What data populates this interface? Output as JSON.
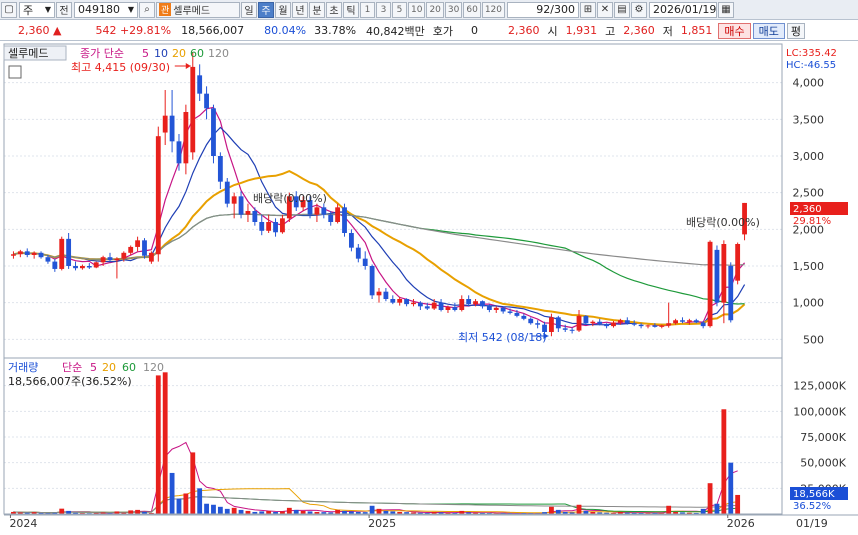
{
  "toolbar": {
    "market": "주",
    "period_prefix": "전",
    "code": "049180",
    "badge": "관",
    "name": "셀루메드",
    "periods": [
      "일",
      "주",
      "월",
      "년",
      "분",
      "초",
      "틱"
    ],
    "active_period": "주",
    "intervals": [
      "1",
      "3",
      "5",
      "10",
      "20",
      "30",
      "60",
      "120"
    ],
    "count": "92/300",
    "date": "2026/01/19"
  },
  "quote": {
    "price": "2,360",
    "arrow": "▲",
    "change": "542",
    "change_pct": "+29.81%",
    "volume": "18,566,007",
    "ratio1": "80.04%",
    "ratio2": "33.78%",
    "amount": "40,842백만",
    "hoga_label": "호가",
    "hoga_value": "0",
    "hoga_price": "2,360",
    "open_label": "시",
    "open": "1,931",
    "high_label": "고",
    "high": "2,360",
    "low_label": "저",
    "low": "1,851",
    "buy_label": "매수",
    "sell_label": "매도",
    "eval_label": "평"
  },
  "price_panel": {
    "legend_name": "셀루메드",
    "legend_ma_prefix": "종가 단순",
    "ma_periods": [
      "5",
      "10",
      "20",
      "60",
      "120"
    ],
    "lc_label": "LC:335.42",
    "hc_label": "HC:-46.55",
    "high_note": "최고 4,415 (09/30)",
    "low_note": "최저 542 (08/18)",
    "dividend_note_1": "배당락(0.00%)",
    "dividend_note_2": "배당락(0.00%)",
    "current_price_tag": "2,360",
    "current_pct_tag": "29.81%"
  },
  "volume_panel": {
    "legend_name": "거래량",
    "legend_ma_prefix": "단순",
    "ma_periods": [
      "5",
      "20",
      "60",
      "120"
    ],
    "volume_note": "18,566,007주(36.52%)",
    "current_volume_tag": "18,566K",
    "current_pct_tag": "36.52%"
  },
  "x_axis_labels": [
    "2024",
    "2025",
    "2026",
    "01/19"
  ],
  "colors": {
    "up": "#e8201c",
    "down": "#2355d6",
    "ma5": "#c71585",
    "ma10": "#1f3fb5",
    "ma20": "#e8a000",
    "ma60": "#1e9a3a",
    "ma120": "#8a8a8a"
  },
  "chart_data": [
    {
      "type": "candlestick",
      "title": "셀루메드",
      "x_range": [
        "2024-01",
        "2026-01-19"
      ],
      "y_ticks": [
        500,
        1000,
        1500,
        2000,
        2500,
        3000,
        3500,
        4000
      ],
      "ylim": [
        300,
        4500
      ],
      "grid": true,
      "candles": [
        {
          "x": "2024-01-05",
          "o": 1640,
          "h": 1700,
          "l": 1600,
          "c": 1660
        },
        {
          "x": "2024-01-12",
          "o": 1660,
          "h": 1720,
          "l": 1620,
          "c": 1700
        },
        {
          "x": "2024-01-19",
          "o": 1700,
          "h": 1740,
          "l": 1620,
          "c": 1650
        },
        {
          "x": "2024-01-26",
          "o": 1650,
          "h": 1700,
          "l": 1600,
          "c": 1680
        },
        {
          "x": "2024-02-02",
          "o": 1680,
          "h": 1700,
          "l": 1600,
          "c": 1620
        },
        {
          "x": "2024-02-09",
          "o": 1620,
          "h": 1650,
          "l": 1530,
          "c": 1560
        },
        {
          "x": "2024-02-16",
          "o": 1560,
          "h": 1600,
          "l": 1420,
          "c": 1460
        },
        {
          "x": "2024-02-23",
          "o": 1460,
          "h": 1900,
          "l": 1440,
          "c": 1870
        },
        {
          "x": "2024-03-01",
          "o": 1870,
          "h": 1950,
          "l": 1460,
          "c": 1500
        },
        {
          "x": "2024-03-08",
          "o": 1500,
          "h": 1560,
          "l": 1440,
          "c": 1470
        },
        {
          "x": "2024-03-15",
          "o": 1470,
          "h": 1520,
          "l": 1450,
          "c": 1500
        },
        {
          "x": "2024-03-22",
          "o": 1500,
          "h": 1540,
          "l": 1460,
          "c": 1480
        },
        {
          "x": "2024-03-29",
          "o": 1480,
          "h": 1560,
          "l": 1470,
          "c": 1550
        },
        {
          "x": "2024-04-05",
          "o": 1550,
          "h": 1640,
          "l": 1500,
          "c": 1620
        },
        {
          "x": "2024-04-12",
          "o": 1620,
          "h": 1680,
          "l": 1560,
          "c": 1580
        },
        {
          "x": "2024-04-19",
          "o": 1580,
          "h": 1620,
          "l": 1330,
          "c": 1600
        },
        {
          "x": "2024-04-26",
          "o": 1600,
          "h": 1700,
          "l": 1560,
          "c": 1680
        },
        {
          "x": "2024-05-03",
          "o": 1680,
          "h": 1780,
          "l": 1650,
          "c": 1760
        },
        {
          "x": "2024-05-10",
          "o": 1760,
          "h": 1900,
          "l": 1700,
          "c": 1850
        },
        {
          "x": "2024-05-17",
          "o": 1850,
          "h": 1880,
          "l": 1600,
          "c": 1640
        },
        {
          "x": "2024-05-24",
          "o": 1560,
          "h": 1700,
          "l": 1530,
          "c": 1680
        },
        {
          "x": "2024-05-31",
          "o": 1660,
          "h": 3400,
          "l": 1560,
          "c": 3270
        },
        {
          "x": "2024-06-07",
          "o": 3320,
          "h": 3900,
          "l": 3150,
          "c": 3550
        },
        {
          "x": "2024-06-14",
          "o": 3550,
          "h": 3900,
          "l": 3050,
          "c": 3200
        },
        {
          "x": "2024-06-21",
          "o": 3200,
          "h": 3300,
          "l": 2800,
          "c": 2900
        },
        {
          "x": "2024-06-28",
          "o": 2900,
          "h": 3700,
          "l": 2750,
          "c": 3600
        },
        {
          "x": "2024-07-05",
          "o": 3050,
          "h": 4415,
          "l": 2950,
          "c": 4215
        },
        {
          "x": "2024-07-12",
          "o": 4100,
          "h": 4250,
          "l": 3750,
          "c": 3850
        },
        {
          "x": "2024-07-19",
          "o": 3850,
          "h": 3950,
          "l": 3500,
          "c": 3650
        },
        {
          "x": "2024-07-26",
          "o": 3650,
          "h": 3700,
          "l": 2900,
          "c": 3000
        },
        {
          "x": "2024-08-02",
          "o": 3000,
          "h": 3050,
          "l": 2550,
          "c": 2650
        },
        {
          "x": "2024-08-09",
          "o": 2650,
          "h": 2700,
          "l": 2300,
          "c": 2350
        },
        {
          "x": "2024-08-16",
          "o": 2350,
          "h": 2500,
          "l": 2150,
          "c": 2450
        },
        {
          "x": "2024-08-23",
          "o": 2450,
          "h": 2520,
          "l": 2150,
          "c": 2200
        },
        {
          "x": "2024-08-30",
          "o": 2200,
          "h": 2350,
          "l": 2100,
          "c": 2250
        },
        {
          "x": "2024-09-06",
          "o": 2250,
          "h": 2300,
          "l": 2050,
          "c": 2100
        },
        {
          "x": "2024-09-13",
          "o": 2100,
          "h": 2200,
          "l": 1920,
          "c": 1980
        },
        {
          "x": "2024-09-20",
          "o": 1980,
          "h": 2200,
          "l": 1950,
          "c": 2100
        },
        {
          "x": "2024-09-27",
          "o": 2100,
          "h": 2150,
          "l": 1900,
          "c": 1960
        },
        {
          "x": "2024-10-04",
          "o": 1960,
          "h": 2200,
          "l": 1940,
          "c": 2150
        },
        {
          "x": "2024-10-11",
          "o": 2150,
          "h": 2500,
          "l": 2100,
          "c": 2450
        },
        {
          "x": "2024-10-18",
          "o": 2450,
          "h": 2520,
          "l": 2250,
          "c": 2300
        },
        {
          "x": "2024-10-25",
          "o": 2300,
          "h": 2450,
          "l": 2250,
          "c": 2400
        },
        {
          "x": "2024-11-01",
          "o": 2400,
          "h": 2450,
          "l": 2150,
          "c": 2200
        },
        {
          "x": "2024-11-08",
          "o": 2200,
          "h": 2350,
          "l": 2100,
          "c": 2300
        },
        {
          "x": "2024-11-15",
          "o": 2300,
          "h": 2350,
          "l": 2150,
          "c": 2200
        },
        {
          "x": "2024-11-22",
          "o": 2200,
          "h": 2250,
          "l": 2050,
          "c": 2100
        },
        {
          "x": "2024-11-29",
          "o": 2100,
          "h": 2350,
          "l": 2080,
          "c": 2300
        },
        {
          "x": "2024-12-06",
          "o": 2300,
          "h": 2350,
          "l": 1900,
          "c": 1950
        },
        {
          "x": "2024-12-13",
          "o": 1950,
          "h": 2000,
          "l": 1700,
          "c": 1750
        },
        {
          "x": "2024-12-20",
          "o": 1750,
          "h": 1800,
          "l": 1550,
          "c": 1600
        },
        {
          "x": "2024-12-27",
          "o": 1600,
          "h": 1700,
          "l": 1450,
          "c": 1500
        },
        {
          "x": "2025-01-03",
          "o": 1500,
          "h": 1520,
          "l": 1050,
          "c": 1100
        },
        {
          "x": "2025-01-10",
          "o": 1100,
          "h": 1200,
          "l": 1000,
          "c": 1150
        },
        {
          "x": "2025-01-17",
          "o": 1150,
          "h": 1200,
          "l": 1020,
          "c": 1050
        },
        {
          "x": "2025-01-24",
          "o": 1050,
          "h": 1100,
          "l": 980,
          "c": 1000
        },
        {
          "x": "2025-01-31",
          "o": 1000,
          "h": 1080,
          "l": 960,
          "c": 1050
        },
        {
          "x": "2025-02-07",
          "o": 1050,
          "h": 1060,
          "l": 950,
          "c": 980
        },
        {
          "x": "2025-02-14",
          "o": 980,
          "h": 1050,
          "l": 950,
          "c": 1000
        },
        {
          "x": "2025-02-21",
          "o": 1000,
          "h": 1020,
          "l": 900,
          "c": 950
        },
        {
          "x": "2025-02-28",
          "o": 950,
          "h": 1000,
          "l": 900,
          "c": 920
        },
        {
          "x": "2025-03-07",
          "o": 920,
          "h": 1050,
          "l": 900,
          "c": 1000
        },
        {
          "x": "2025-03-14",
          "o": 1000,
          "h": 1050,
          "l": 880,
          "c": 900
        },
        {
          "x": "2025-03-21",
          "o": 900,
          "h": 960,
          "l": 860,
          "c": 940
        },
        {
          "x": "2025-03-28",
          "o": 940,
          "h": 1000,
          "l": 880,
          "c": 900
        },
        {
          "x": "2025-04-04",
          "o": 900,
          "h": 1100,
          "l": 880,
          "c": 1050
        },
        {
          "x": "2025-04-11",
          "o": 1050,
          "h": 1100,
          "l": 950,
          "c": 980
        },
        {
          "x": "2025-04-18",
          "o": 980,
          "h": 1050,
          "l": 950,
          "c": 1020
        },
        {
          "x": "2025-04-25",
          "o": 1020,
          "h": 1030,
          "l": 920,
          "c": 950
        },
        {
          "x": "2025-05-02",
          "o": 950,
          "h": 980,
          "l": 870,
          "c": 900
        },
        {
          "x": "2025-05-09",
          "o": 900,
          "h": 950,
          "l": 860,
          "c": 930
        },
        {
          "x": "2025-05-16",
          "o": 930,
          "h": 950,
          "l": 850,
          "c": 880
        },
        {
          "x": "2025-05-23",
          "o": 880,
          "h": 920,
          "l": 840,
          "c": 860
        },
        {
          "x": "2025-05-30",
          "o": 860,
          "h": 900,
          "l": 800,
          "c": 820
        },
        {
          "x": "2025-06-06",
          "o": 820,
          "h": 850,
          "l": 760,
          "c": 780
        },
        {
          "x": "2025-06-13",
          "o": 780,
          "h": 800,
          "l": 700,
          "c": 720
        },
        {
          "x": "2025-06-20",
          "o": 720,
          "h": 760,
          "l": 650,
          "c": 700
        },
        {
          "x": "2025-06-27",
          "o": 700,
          "h": 740,
          "l": 560,
          "c": 600
        },
        {
          "x": "2025-07-04",
          "o": 600,
          "h": 850,
          "l": 542,
          "c": 800
        },
        {
          "x": "2025-07-11",
          "o": 800,
          "h": 820,
          "l": 600,
          "c": 650
        },
        {
          "x": "2025-07-18",
          "o": 650,
          "h": 700,
          "l": 600,
          "c": 630
        },
        {
          "x": "2025-07-25",
          "o": 630,
          "h": 660,
          "l": 580,
          "c": 620
        },
        {
          "x": "2025-08-01",
          "o": 620,
          "h": 900,
          "l": 600,
          "c": 820
        },
        {
          "x": "2025-08-08",
          "o": 820,
          "h": 830,
          "l": 700,
          "c": 720
        },
        {
          "x": "2025-08-15",
          "o": 720,
          "h": 760,
          "l": 680,
          "c": 740
        },
        {
          "x": "2025-08-22",
          "o": 740,
          "h": 780,
          "l": 690,
          "c": 710
        },
        {
          "x": "2025-08-29",
          "o": 710,
          "h": 720,
          "l": 650,
          "c": 680
        },
        {
          "x": "2025-09-05",
          "o": 680,
          "h": 750,
          "l": 660,
          "c": 730
        },
        {
          "x": "2025-09-12",
          "o": 730,
          "h": 780,
          "l": 700,
          "c": 760
        },
        {
          "x": "2025-09-19",
          "o": 760,
          "h": 800,
          "l": 700,
          "c": 720
        },
        {
          "x": "2025-09-26",
          "o": 720,
          "h": 760,
          "l": 680,
          "c": 700
        },
        {
          "x": "2025-10-03",
          "o": 700,
          "h": 720,
          "l": 650,
          "c": 680
        },
        {
          "x": "2025-10-10",
          "o": 680,
          "h": 700,
          "l": 650,
          "c": 690
        },
        {
          "x": "2025-10-17",
          "o": 690,
          "h": 720,
          "l": 660,
          "c": 670
        },
        {
          "x": "2025-10-24",
          "o": 670,
          "h": 700,
          "l": 650,
          "c": 690
        },
        {
          "x": "2025-10-31",
          "o": 690,
          "h": 1000,
          "l": 660,
          "c": 720
        },
        {
          "x": "2025-11-07",
          "o": 720,
          "h": 780,
          "l": 700,
          "c": 760
        },
        {
          "x": "2025-11-14",
          "o": 760,
          "h": 800,
          "l": 720,
          "c": 740
        },
        {
          "x": "2025-11-21",
          "o": 740,
          "h": 780,
          "l": 700,
          "c": 760
        },
        {
          "x": "2025-11-28",
          "o": 760,
          "h": 780,
          "l": 720,
          "c": 730
        },
        {
          "x": "2025-12-05",
          "o": 730,
          "h": 750,
          "l": 650,
          "c": 680
        },
        {
          "x": "2025-12-12",
          "o": 680,
          "h": 1850,
          "l": 660,
          "c": 1830
        },
        {
          "x": "2025-12-19",
          "o": 1720,
          "h": 1780,
          "l": 950,
          "c": 1000
        },
        {
          "x": "2025-12-26",
          "o": 1000,
          "h": 1850,
          "l": 720,
          "c": 1800
        },
        {
          "x": "2026-01-02",
          "o": 1500,
          "h": 1550,
          "l": 730,
          "c": 760
        },
        {
          "x": "2026-01-09",
          "o": 1300,
          "h": 1820,
          "l": 1250,
          "c": 1800
        },
        {
          "x": "2026-01-16",
          "o": 1931,
          "h": 2360,
          "l": 1851,
          "c": 2360
        }
      ],
      "moving_averages": [
        {
          "name": "5",
          "period": 5
        },
        {
          "name": "10",
          "period": 10
        },
        {
          "name": "20",
          "period": 20
        },
        {
          "name": "60",
          "period": 60
        },
        {
          "name": "120",
          "period": 120
        }
      ]
    },
    {
      "type": "bar",
      "title": "거래량",
      "y_ticks": [
        25000,
        50000,
        75000,
        100000,
        125000
      ],
      "y_tick_labels": [
        "25,000K",
        "50,000K",
        "75,000K",
        "100,000K",
        "125,000K"
      ],
      "ylim": [
        0,
        150000
      ],
      "unit": "K",
      "values": [
        2000,
        1500,
        1200,
        1800,
        1000,
        900,
        1100,
        5200,
        3000,
        1200,
        900,
        800,
        1000,
        1500,
        900,
        2500,
        1200,
        3500,
        4000,
        2000,
        1000,
        135000,
        138000,
        40000,
        15000,
        20000,
        60000,
        25000,
        10000,
        9000,
        7000,
        5000,
        6000,
        4000,
        3000,
        2000,
        2500,
        3000,
        2000,
        2500,
        6000,
        4000,
        3000,
        2500,
        2000,
        1800,
        1500,
        4000,
        3000,
        2500,
        2000,
        1800,
        8000,
        5000,
        3000,
        2500,
        2000,
        1800,
        1500,
        1200,
        1000,
        2000,
        1500,
        1200,
        1000,
        3000,
        1500,
        1200,
        1000,
        900,
        800,
        900,
        800,
        700,
        900,
        800,
        700,
        1800,
        7000,
        4000,
        2000,
        1500,
        9000,
        3000,
        2000,
        1500,
        1200,
        1000,
        2000,
        1500,
        1200,
        1000,
        900,
        1000,
        900,
        8000,
        2000,
        1500,
        1200,
        1000,
        5000,
        30000,
        10000,
        102000,
        50000,
        18566
      ]
    }
  ]
}
